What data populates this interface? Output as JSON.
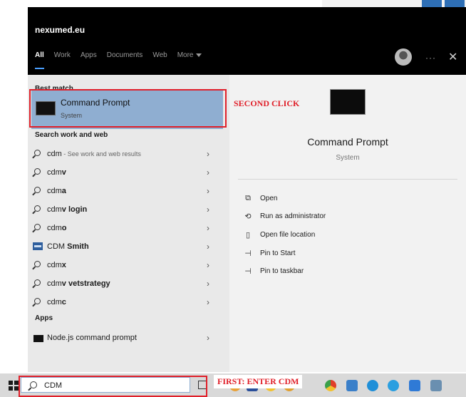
{
  "header": {
    "account": "nexumed.eu",
    "tabs": [
      {
        "label": "All",
        "active": true
      },
      {
        "label": "Work"
      },
      {
        "label": "Apps"
      },
      {
        "label": "Documents"
      },
      {
        "label": "Web"
      },
      {
        "label": "More"
      }
    ],
    "more_icon": "dots-icon",
    "close_icon": "close-icon"
  },
  "results": {
    "best_match_label": "Best match",
    "best_match": {
      "title": "Command Prompt",
      "subtitle": "System"
    },
    "search_section_label": "Search work and web",
    "items": [
      {
        "prefix": "cdm",
        "bold": "",
        "hint": " - See work and web results"
      },
      {
        "prefix": "cdm",
        "bold": "v",
        "hint": ""
      },
      {
        "prefix": "cdm",
        "bold": "a",
        "hint": ""
      },
      {
        "prefix": "cdm",
        "bold": "v login",
        "hint": ""
      },
      {
        "prefix": "cdm",
        "bold": "o",
        "hint": ""
      },
      {
        "prefix": "CDM ",
        "bold": "Smith",
        "hint": ""
      },
      {
        "prefix": "cdm",
        "bold": "x",
        "hint": ""
      },
      {
        "prefix": "cdm",
        "bold": "v vetstrategy",
        "hint": ""
      },
      {
        "prefix": "cdm",
        "bold": "c",
        "hint": ""
      }
    ],
    "apps_label": "Apps",
    "apps": [
      {
        "label": "Node.js command prompt"
      }
    ]
  },
  "detail": {
    "title": "Command Prompt",
    "subtitle": "System",
    "actions": [
      {
        "icon": "open-icon",
        "label": "Open"
      },
      {
        "icon": "shield-admin-icon",
        "label": "Run as administrator"
      },
      {
        "icon": "file-location-icon",
        "label": "Open file location"
      },
      {
        "icon": "pin-icon",
        "label": "Pin to Start"
      },
      {
        "icon": "pin-icon",
        "label": "Pin to taskbar"
      }
    ]
  },
  "annotations": {
    "second": "SECOND CLICK",
    "first": "FIRST: ENTER CDM"
  },
  "taskbar": {
    "search_value": "CDM"
  },
  "colors": {
    "selection": "#8faed1",
    "annotation": "#e0202a",
    "edge": "#1f8fd8",
    "chrome_ring": "#f2c230"
  }
}
